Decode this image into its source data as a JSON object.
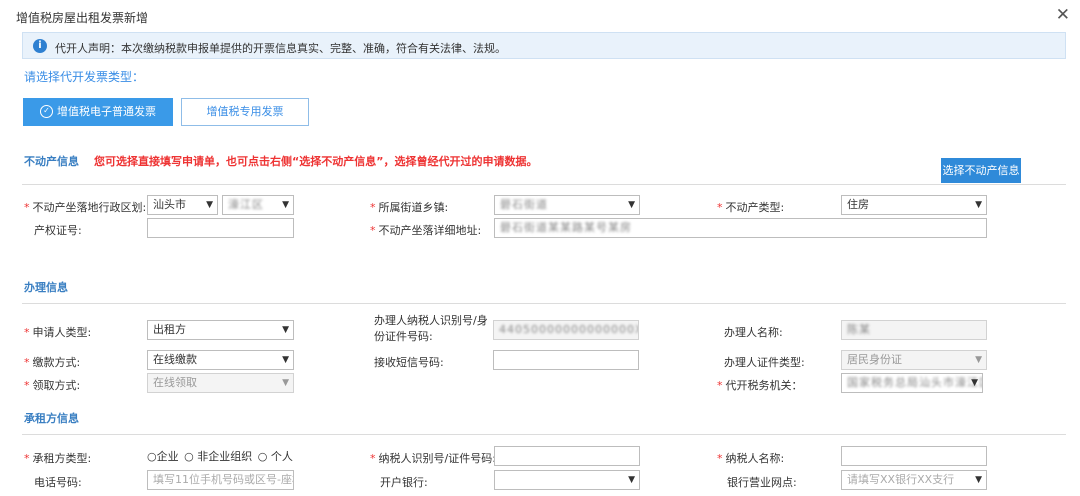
{
  "window": {
    "title": "增值税房屋出租发票新增",
    "close_glyph": "✕"
  },
  "notice": {
    "icon": "info-icon",
    "text": "代开人声明：本次缴纳税款申报单提供的开票信息真实、完整、准确，符合有关法律、法规。"
  },
  "invoice_type": {
    "prompt": "请选择代开发票类型：",
    "options": [
      {
        "label": "增值税电子普通发票",
        "selected": true
      },
      {
        "label": "增值税专用发票",
        "selected": false
      }
    ]
  },
  "property": {
    "section_title": "不动产信息",
    "warning": "您可选择直接填写申请单，也可点击右侧“选择不动产信息”，选择曾经代开过的申请数据。",
    "pick_button": "选择不动产信息",
    "labels": {
      "admin_region": "不动产坐落地行政区划:",
      "street": "所属街道乡镇:",
      "type": "不动产类型:",
      "cert_no": "产权证号:",
      "address": "不动产坐落详细地址:"
    },
    "values": {
      "city": "汕头市",
      "district": "濠江区",
      "street": "礐石街道",
      "type": "住房",
      "cert_no": "",
      "address": "礐石街道某某路某号某房"
    }
  },
  "handling": {
    "section_title": "办理信息",
    "labels": {
      "applicant_type": "申请人类型:",
      "payment_method": "缴款方式:",
      "pickup_method": "领取方式:",
      "agent_tax_id": "办理人纳税人识别号/身份证件号码:",
      "sms_number": "接收短信号码:",
      "agent_name": "办理人名称:",
      "agent_id_type": "办理人证件类型:",
      "tax_office": "代开税务机关："
    },
    "values": {
      "applicant_type": "出租方",
      "payment_method": "在线缴款",
      "pickup_method": "在线领取",
      "agent_tax_id": "44050000000000000X",
      "sms_number": "",
      "agent_name": "陈某",
      "agent_id_type": "居民身份证",
      "tax_office": "国家税务总局汕头市濠江区税务局"
    }
  },
  "lessee": {
    "section_title": "承租方信息",
    "labels": {
      "lessee_type": "承租方类型:",
      "taxpayer_id": "纳税人识别号/证件号码:",
      "taxpayer_name": "纳税人名称:",
      "phone": "电话号码:",
      "bank": "开户银行:",
      "bank_branch": "银行营业网点:"
    },
    "radio_options": [
      "○企业",
      "○ 非企业组织",
      "○ 个人"
    ],
    "placeholders": {
      "phone": "填写11位手机号码或区号-座机",
      "bank_branch": "请填写XX银行XX支行"
    },
    "values": {
      "taxpayer_id": "",
      "taxpayer_name": "",
      "bank": ""
    }
  },
  "ui": {
    "required_mark": "*",
    "caret": "▼"
  }
}
